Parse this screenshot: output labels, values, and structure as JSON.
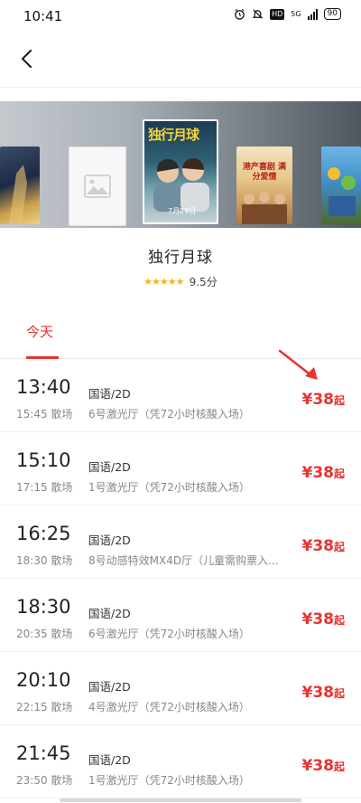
{
  "status_bar": {
    "time": "10:41",
    "network": "5G",
    "battery": "90"
  },
  "movie": {
    "title": "独行月球",
    "stars": "★★★★★",
    "score": "9.5分",
    "poster_title": "独行月球",
    "poster_date": "7月29日",
    "poster_right_title": "港产喜剧 满分爱情"
  },
  "date_tab": {
    "label": "今天"
  },
  "sessions": [
    {
      "start": "13:40",
      "end": "15:45 散场",
      "lang": "国语/2D",
      "hall": "6号激光厅（凭72小时核酸入场）",
      "price": "¥38",
      "suffix": "起"
    },
    {
      "start": "15:10",
      "end": "17:15 散场",
      "lang": "国语/2D",
      "hall": "1号激光厅（凭72小时核酸入场）",
      "price": "¥38",
      "suffix": "起"
    },
    {
      "start": "16:25",
      "end": "18:30 散场",
      "lang": "国语/2D",
      "hall": "8号动感特效MX4D厅（儿童需购票入...",
      "price": "¥38",
      "suffix": "起"
    },
    {
      "start": "18:30",
      "end": "20:35 散场",
      "lang": "国语/2D",
      "hall": "6号激光厅（凭72小时核酸入场）",
      "price": "¥38",
      "suffix": "起"
    },
    {
      "start": "20:10",
      "end": "22:15 散场",
      "lang": "国语/2D",
      "hall": "4号激光厅（凭72小时核酸入场）",
      "price": "¥38",
      "suffix": "起"
    },
    {
      "start": "21:45",
      "end": "23:50 散场",
      "lang": "国语/2D",
      "hall": "1号激光厅（凭72小时核酸入场）",
      "price": "¥38",
      "suffix": "起"
    }
  ],
  "colors": {
    "accent": "#e8332f",
    "star": "#f8b51a"
  }
}
